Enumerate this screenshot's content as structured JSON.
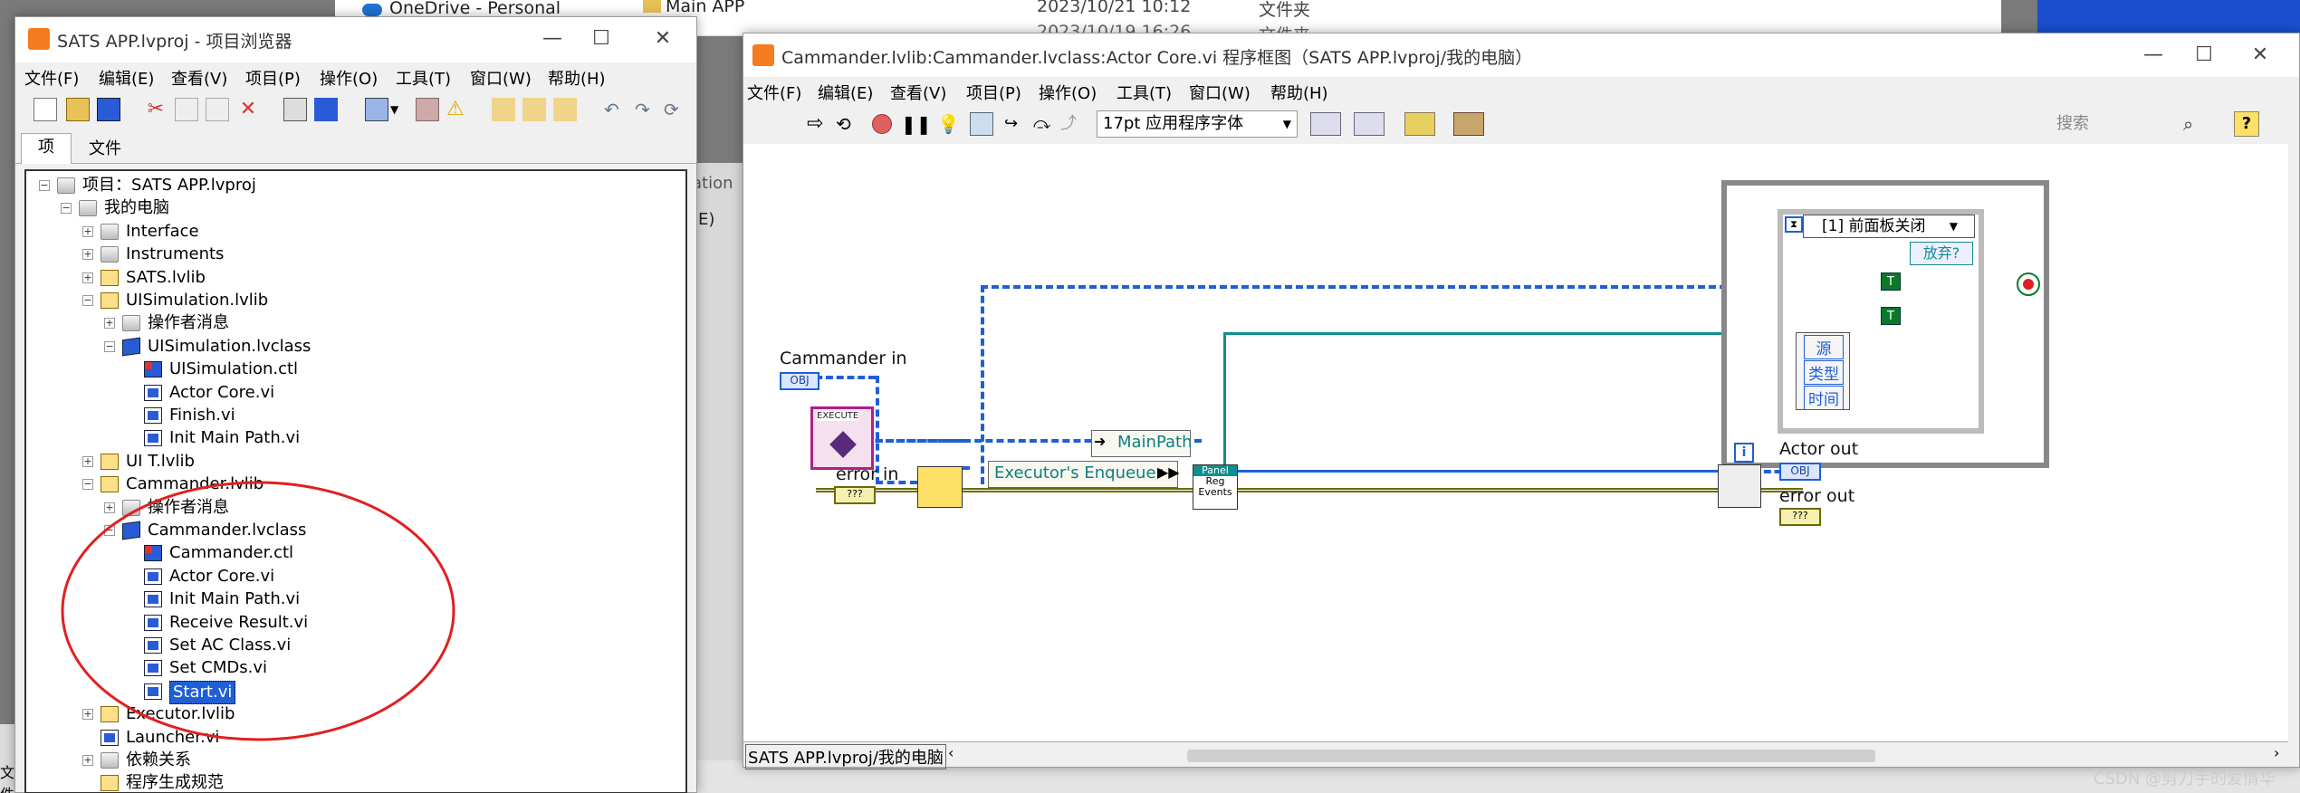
{
  "background": {
    "explorer_item": "OneDrive - Personal",
    "file_row1": {
      "name": "Main APP",
      "date": "2023/10/21 10:12",
      "type": "文件夹"
    },
    "file_row2": {
      "date": "2023/10/19 16:26",
      "type": "文件夹"
    },
    "partial_menu": "ation",
    "partial_menu2": "(E)",
    "left_partial": "文件"
  },
  "project_window": {
    "title": "SATS APP.lvproj - 项目浏览器",
    "menu": [
      "文件(F)",
      "编辑(E)",
      "查看(V)",
      "项目(P)",
      "操作(O)",
      "工具(T)",
      "窗口(W)",
      "帮助(H)"
    ],
    "tabs": [
      "项",
      "文件"
    ],
    "tree": [
      {
        "label": "项目：SATS APP.lvproj",
        "level": 0,
        "icon": "project-icon",
        "expander": "−"
      },
      {
        "label": "我的电脑",
        "level": 1,
        "icon": "computer-icon",
        "expander": "−"
      },
      {
        "label": "Interface",
        "level": 2,
        "icon": "folder-icon",
        "expander": "+"
      },
      {
        "label": "Instruments",
        "level": 2,
        "icon": "folder-icon",
        "expander": "+"
      },
      {
        "label": "SATS.lvlib",
        "level": 2,
        "icon": "library-icon",
        "expander": "+"
      },
      {
        "label": "UISimulation.lvlib",
        "level": 2,
        "icon": "library-icon",
        "expander": "−"
      },
      {
        "label": "操作者消息",
        "level": 3,
        "icon": "folder-icon",
        "expander": "+"
      },
      {
        "label": "UISimulation.lvclass",
        "level": 3,
        "icon": "class-icon",
        "expander": "−"
      },
      {
        "label": "UISimulation.ctl",
        "level": 4,
        "icon": "ctl-icon",
        "expander": ""
      },
      {
        "label": "Actor Core.vi",
        "level": 4,
        "icon": "vi-icon",
        "expander": ""
      },
      {
        "label": "Finish.vi",
        "level": 4,
        "icon": "vi-icon",
        "expander": ""
      },
      {
        "label": "Init Main Path.vi",
        "level": 4,
        "icon": "vi-icon",
        "expander": ""
      },
      {
        "label": "UI T.lvlib",
        "level": 2,
        "icon": "library-icon",
        "expander": "+"
      },
      {
        "label": "Cammander.lvlib",
        "level": 2,
        "icon": "library-icon",
        "expander": "−"
      },
      {
        "label": "操作者消息",
        "level": 3,
        "icon": "folder-icon",
        "expander": "+"
      },
      {
        "label": "Cammander.lvclass",
        "level": 3,
        "icon": "class-icon",
        "expander": "−"
      },
      {
        "label": "Cammander.ctl",
        "level": 4,
        "icon": "ctl-icon",
        "expander": ""
      },
      {
        "label": "Actor Core.vi",
        "level": 4,
        "icon": "vi-icon",
        "expander": ""
      },
      {
        "label": "Init Main Path.vi",
        "level": 4,
        "icon": "vi-icon",
        "expander": ""
      },
      {
        "label": "Receive Result.vi",
        "level": 4,
        "icon": "vi-icon",
        "expander": ""
      },
      {
        "label": "Set AC Class.vi",
        "level": 4,
        "icon": "vi-icon",
        "expander": ""
      },
      {
        "label": "Set CMDs.vi",
        "level": 4,
        "icon": "vi-icon",
        "expander": ""
      },
      {
        "label": "Start.vi",
        "level": 4,
        "icon": "vi-icon",
        "expander": "",
        "selected": true
      },
      {
        "label": "Executor.lvlib",
        "level": 2,
        "icon": "library-icon",
        "expander": "+"
      },
      {
        "label": "Launcher.vi",
        "level": 2,
        "icon": "vi-icon",
        "expander": ""
      },
      {
        "label": "依赖关系",
        "level": 2,
        "icon": "dependencies-icon",
        "expander": "+"
      },
      {
        "label": "程序生成规范",
        "level": 2,
        "icon": "build-spec-icon",
        "expander": ""
      }
    ],
    "annotation_color": "#e02020"
  },
  "block_diagram_window": {
    "title": "Cammander.lvlib:Cammander.lvclass:Actor Core.vi 程序框图（SATS APP.lvproj/我的电脑）",
    "menu": [
      "文件(F)",
      "编辑(E)",
      "查看(V)",
      "项目(P)",
      "操作(O)",
      "工具(T)",
      "窗口(W)",
      "帮助(H)"
    ],
    "font_select": "17pt 应用程序字体",
    "search_placeholder": "搜索",
    "status_context": "SATS APP.lvproj/我的电脑",
    "diagram": {
      "cammander_in": "Cammander in",
      "obj_term": "OBJ",
      "execute_label": "EXECUTE",
      "error_in": "error in",
      "mainpath": "MainPath",
      "executor_enqueuer": "Executor's Enqueuer",
      "reg_events_top": "Panel",
      "reg_events_1": "Reg",
      "reg_events_2": "Events",
      "event_case": "[1] 前面板关闭",
      "abort": "放弃?",
      "event_data": [
        "源",
        "类型",
        "时间"
      ],
      "loop_index": "i",
      "bool_t": "T",
      "actor_out": "Actor out",
      "error_out": "error out",
      "cluster_term": "???"
    },
    "wire_colors": {
      "object": "#1f5fd7",
      "refnum": "#0f8f8f",
      "error": "#6b6b00"
    }
  },
  "watermark": "CSDN @剪刀手的爱情华"
}
